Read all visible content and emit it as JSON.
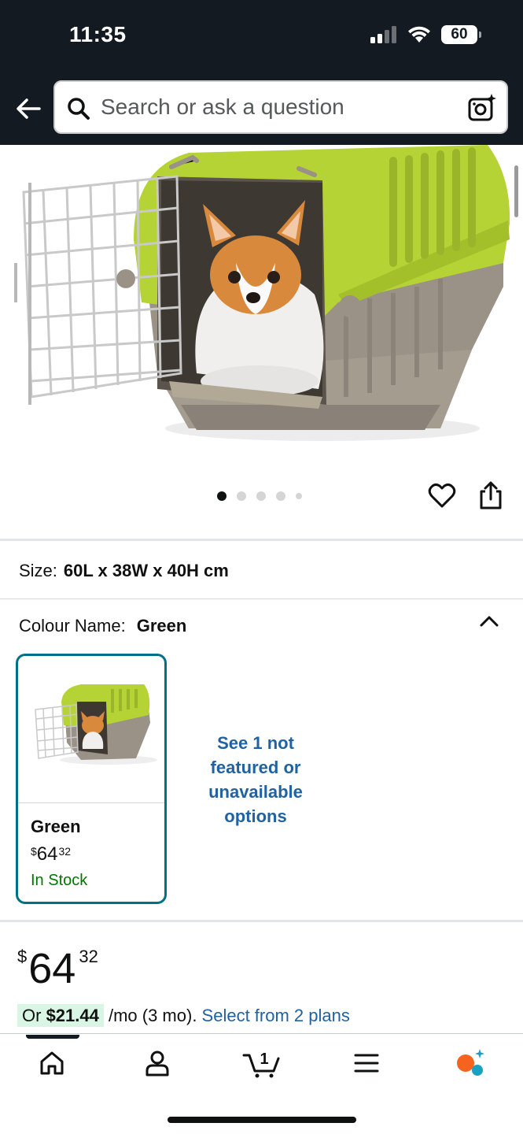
{
  "status_bar": {
    "time": "11:35",
    "battery": "60"
  },
  "search": {
    "placeholder": "Search or ask a question"
  },
  "gallery": {
    "total_images": 5,
    "active_index": 0
  },
  "size": {
    "label": "Size:",
    "value": "60L x 38W x 40H cm"
  },
  "colour": {
    "label": "Colour Name:",
    "value": "Green"
  },
  "swatch": {
    "name": "Green",
    "price_currency": "$",
    "price_whole": "64",
    "price_cents": "32",
    "stock": "In Stock"
  },
  "see_more": "See 1 not featured or unavailable options",
  "price": {
    "currency": "$",
    "whole": "64",
    "cents": "32"
  },
  "installment": {
    "prefix": "Or ",
    "amount": "$21.44",
    "suffix": " /mo (3 mo). ",
    "link": "Select from 2 plans"
  },
  "bottom_nav": {
    "cart_count": "1",
    "items": [
      "home-icon",
      "account-icon",
      "cart-icon",
      "menu-icon",
      "rufus-icon"
    ]
  },
  "colors": {
    "header_bg": "#131a22",
    "link": "#2162a1",
    "swatch_border": "#007185",
    "in_stock": "#007600",
    "installment_highlight": "#d9f5e3",
    "rufus_orange": "#f5631e",
    "rufus_teal": "#1ca0c1"
  }
}
